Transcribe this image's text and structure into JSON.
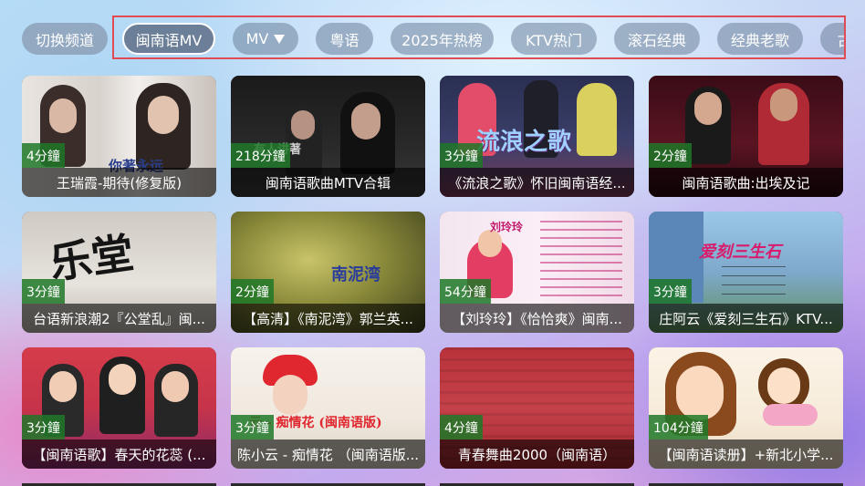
{
  "header": {
    "switch_label": "切换频道",
    "tabs": [
      {
        "label": "闽南语MV",
        "active": true
      },
      {
        "label": "MV",
        "has_filter": true
      },
      {
        "label": "粤语"
      },
      {
        "label": "2025年热榜"
      },
      {
        "label": "KTV热门"
      },
      {
        "label": "滚石经典"
      },
      {
        "label": "经典老歌"
      },
      {
        "label": "古风MV"
      }
    ]
  },
  "videos": [
    {
      "duration": "4分鐘",
      "title": "王瑞霞-期待(修复版)",
      "overlay_text": "你著永远"
    },
    {
      "duration": "218分鐘",
      "title": "闽南语歌曲MTV合辑",
      "overlay_text": "有人讲著"
    },
    {
      "duration": "3分鐘",
      "title": "《流浪之歌》怀旧闽南语经...",
      "overlay_text": "流浪之歌"
    },
    {
      "duration": "2分鐘",
      "title": "闽南语歌曲:出埃及记",
      "overlay_text": ""
    },
    {
      "duration": "3分鐘",
      "title": "台语新浪潮2『公堂乱』闽...",
      "overlay_text": "乐堂"
    },
    {
      "duration": "2分鐘",
      "title": "【高清】《南泥湾》郭兰英...",
      "overlay_text": "南泥湾"
    },
    {
      "duration": "54分鐘",
      "title": "【刘玲玲】《恰恰爽》闽南...",
      "overlay_text": "刘玲玲"
    },
    {
      "duration": "3分鐘",
      "title": "庄阿云《爱刻三生石》KTV...",
      "overlay_text": "爱刻三生石"
    },
    {
      "duration": "3分鐘",
      "title": "【闽南语歌】春天的花蕊 (...",
      "overlay_text": ""
    },
    {
      "duration": "3分鐘",
      "title": "陈小云 - 痴情花 （闽南语版...",
      "overlay_text": "云 - 痴情花 (闽南语版)"
    },
    {
      "duration": "4分鐘",
      "title": "青春舞曲2000（闽南语）",
      "overlay_text": ""
    },
    {
      "duration": "104分鐘",
      "title": "【闽南语读册】+新北小学...",
      "overlay_text": ""
    }
  ],
  "colors": {
    "duration_badge": "#1e7828",
    "tab_outline": "#e04b55",
    "tab_bg": "#6e829b"
  }
}
